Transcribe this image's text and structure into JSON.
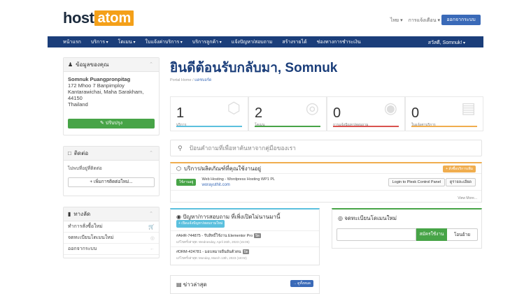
{
  "header": {
    "logo_host": "host",
    "logo_atom": "atom",
    "language": "ไทย",
    "notifications": "การแจ้งเตือน",
    "logout": "ออกจากระบบ"
  },
  "nav": {
    "items": [
      "หน้าแรก",
      "บริการ",
      "โดเมน",
      "ใบแจ้งค่าบริการ",
      "บริการลูกค้า",
      "แจ้งปัญหา/สอบถาม",
      "สร้างรายได้",
      "ช่องทางการชำระเงิน"
    ],
    "greeting": "สวัสดี, Somnuk!"
  },
  "sidebar": {
    "info_title": "ข้อมูลของคุณ",
    "name": "Somnuk Puangpronpitag",
    "address1": "172 Mhoo 7 Banpimploy",
    "address2": "Kantarawichai, Maha Sarakham,",
    "postcode": "44150",
    "country": "Thailand",
    "update_button": "ปรับปรุง",
    "contacts_title": "ติดต่อ",
    "contacts_empty": "ไม่พบที่อยู่ที่ติดต่อ",
    "new_contact_button": "+ เพิ่มการติดต่อใหม่...",
    "shortcuts_title": "ทางลัด",
    "shortcuts": [
      "ทำการสั่งซื้อใหม่",
      "จดทะเบียนโดเมนใหม่",
      "ออกจากระบบ"
    ]
  },
  "main": {
    "welcome": "ยินดีต้อนรับกลับมา, Somnuk",
    "breadcrumb_home": "Portal Home",
    "breadcrumb_current": "แดชบอร์ด",
    "stats": [
      {
        "value": "1",
        "label": "บริการ",
        "color": "#5bc0de"
      },
      {
        "value": "2",
        "label": "โดเมน",
        "color": "#47a447"
      },
      {
        "value": "0",
        "label": "การแจ้งปัญหา/สอบถาม",
        "color": "#d9534f"
      },
      {
        "value": "0",
        "label": "ใบแจ้งค่าบริการ",
        "color": "#f0ad4e"
      }
    ],
    "search_placeholder": "ป้อนคำถามที่เพื่อหาค้นหาจากคู่มือของเรา"
  },
  "products": {
    "title": "บริการ/ผลิตภัณฑ์ที่คุณใช้งานอยู่",
    "order_badge": "+ สั่งซื้อบริการเพิ่ม",
    "status": "ใช้งานอยู่",
    "service_name": "Web Hosting - Wordpress Hosting WP1 PL",
    "domain": "worayuthit.com",
    "login_button": "Login to Plesk Control Panel",
    "details_button": "ดูรายละเอียด",
    "view_more": "View More..."
  },
  "tickets": {
    "title": "ปัญหา/การสอบถาม ที่เพิ่งเปิดไม่นานมานี้",
    "new_badge": "+ เปิดแจ้งปัญหา/สอบถามใหม่",
    "items": [
      {
        "subject": "#AHR-744875 - รับสิทธิ์ใช้งาน Elementor Pro",
        "tag": "ปิด",
        "meta": "แก้ไขครั้งล่าสุด: Wednesday, April 26th, 2023 (15:05)"
      },
      {
        "subject": "#DRM-424781 - มอบหมายยืนยันตัวตน",
        "tag": "ปิด",
        "meta": "แก้ไขครั้งล่าสุด: Monday, March 13th, 2023 (18:02)"
      }
    ]
  },
  "domain_register": {
    "title": "จดทะเบียนโดเมนใหม่",
    "register_button": "สมัครใช้งาน",
    "transfer_button": "โอนย้าย"
  },
  "news": {
    "title": "ข่าวล่าสุด",
    "view_all": "→ ดูทั้งหมด"
  }
}
